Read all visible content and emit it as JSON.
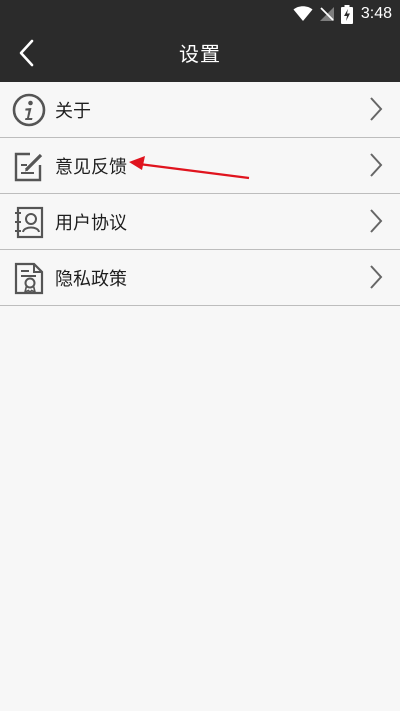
{
  "status_bar": {
    "time": "3:48",
    "icons": [
      "wifi-icon",
      "no-signal-icon",
      "battery-charging-icon"
    ]
  },
  "header": {
    "back_icon": "back-arrow-icon",
    "title": "设置"
  },
  "menu": {
    "items": [
      {
        "label": "关于",
        "icon": "info-icon"
      },
      {
        "label": "意见反馈",
        "icon": "edit-feedback-icon"
      },
      {
        "label": "用户协议",
        "icon": "user-agreement-icon"
      },
      {
        "label": "隐私政策",
        "icon": "privacy-certificate-icon"
      }
    ]
  },
  "annotation": {
    "color": "#e0141e",
    "target": "意见反馈"
  },
  "colors": {
    "header_bg": "#2b2b2b",
    "page_bg": "#f7f7f7",
    "divider": "#bdbdbd"
  }
}
